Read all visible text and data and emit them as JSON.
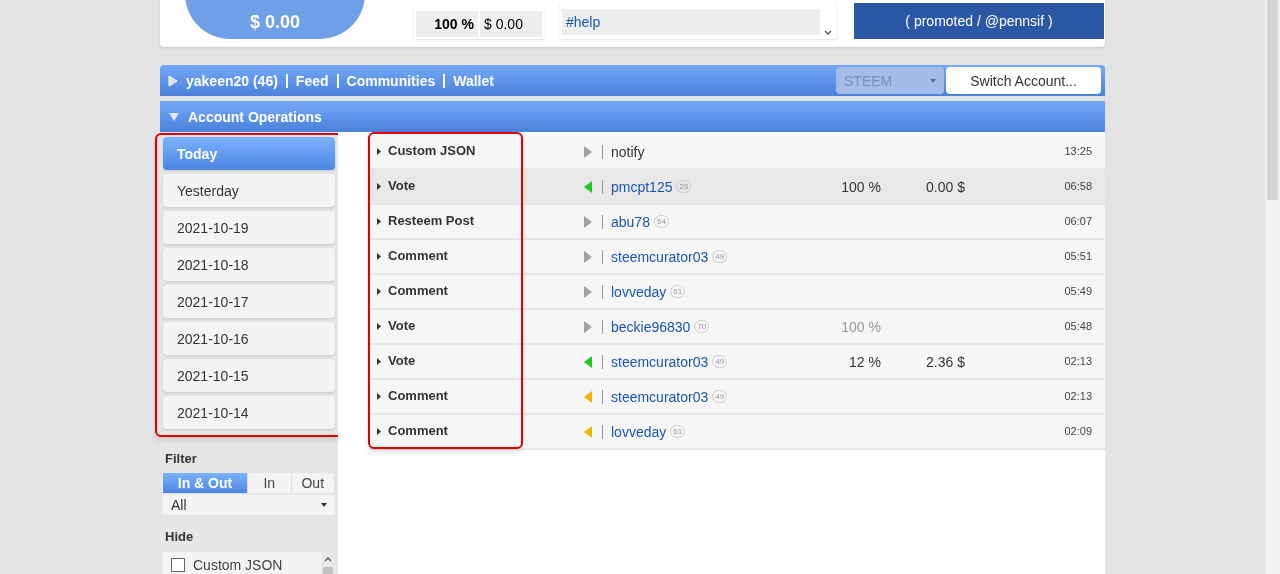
{
  "top": {
    "wallet_amount": "$ 0.00",
    "vote_stats": [
      "100 %",
      "$ 0.00"
    ],
    "tag": "#help",
    "promo": "( promoted / @pennsif )"
  },
  "nav": {
    "links": [
      "yakeen20 (46)",
      "Feed",
      "Communities",
      "Wallet"
    ],
    "currency": "STEEM",
    "switch_button": "Switch Account..."
  },
  "section": {
    "title": "Account Operations",
    "expanded": true
  },
  "days": [
    {
      "label": "Today",
      "selected": true
    },
    {
      "label": "Yesterday",
      "selected": false
    },
    {
      "label": "2021-10-19",
      "selected": false
    },
    {
      "label": "2021-10-18",
      "selected": false
    },
    {
      "label": "2021-10-17",
      "selected": false
    },
    {
      "label": "2021-10-16",
      "selected": false
    },
    {
      "label": "2021-10-15",
      "selected": false
    },
    {
      "label": "2021-10-14",
      "selected": false
    }
  ],
  "filter": {
    "title": "Filter",
    "options": [
      {
        "label": "In & Out",
        "selected": true
      },
      {
        "label": "In",
        "selected": false
      },
      {
        "label": "Out",
        "selected": false
      }
    ],
    "select": "All"
  },
  "hide": {
    "title": "Hide",
    "items": [
      {
        "label": "Custom JSON",
        "checked": false
      }
    ]
  },
  "operations": [
    {
      "type": "Custom JSON",
      "kind": "out",
      "color": "#a0a0a0",
      "account": "notify",
      "link": false,
      "selected": false,
      "time": "13:25"
    },
    {
      "type": "Vote",
      "kind": "in",
      "color": "#1ec81e",
      "account": "pmcpt125",
      "rep": "25",
      "percent": "100 %",
      "percent_muted": false,
      "value": "0.00 $",
      "link": true,
      "selected": true,
      "time": "06:58"
    },
    {
      "type": "Resteem Post",
      "kind": "out",
      "color": "#a0a0a0",
      "account": "abu78",
      "rep": "64",
      "link": true,
      "selected": false,
      "time": "06:07"
    },
    {
      "type": "Comment",
      "kind": "out",
      "color": "#a0a0a0",
      "account": "steemcurator03",
      "rep": "49",
      "link": true,
      "selected": false,
      "time": "05:51"
    },
    {
      "type": "Comment",
      "kind": "out",
      "color": "#a0a0a0",
      "account": "lovveday",
      "rep": "61",
      "link": true,
      "selected": false,
      "time": "05:49"
    },
    {
      "type": "Vote",
      "kind": "out",
      "color": "#a0a0a0",
      "account": "beckie96830",
      "rep": "70",
      "percent": "100 %",
      "percent_muted": true,
      "link": true,
      "selected": false,
      "time": "05:48"
    },
    {
      "type": "Vote",
      "kind": "in",
      "color": "#1ec81e",
      "account": "steemcurator03",
      "rep": "49",
      "percent": "12 %",
      "percent_muted": false,
      "value": "2.36 $",
      "link": true,
      "selected": false,
      "time": "02:13"
    },
    {
      "type": "Comment",
      "kind": "in",
      "color": "#f0b400",
      "account": "steemcurator03",
      "rep": "49",
      "link": true,
      "selected": false,
      "time": "02:13"
    },
    {
      "type": "Comment",
      "kind": "in",
      "color": "#f0b400",
      "account": "lovveday",
      "rep": "61",
      "link": true,
      "selected": false,
      "time": "02:09"
    }
  ]
}
